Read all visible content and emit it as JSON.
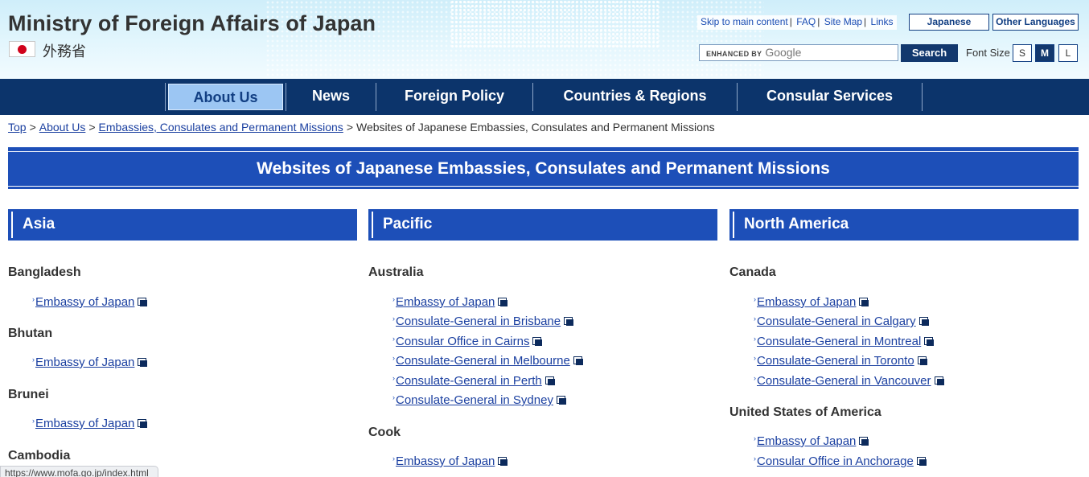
{
  "header": {
    "site_title": "Ministry of Foreign Affairs of Japan",
    "japanese_name": "外務省",
    "utility_links": [
      "Skip to main content",
      "FAQ",
      "Site Map",
      "Links"
    ],
    "language_buttons": [
      "Japanese",
      "Other Languages"
    ],
    "search": {
      "enhanced_label": "ENHANCED BY",
      "google_label": "Google",
      "button_label": "Search"
    },
    "font_size": {
      "label": "Font Size",
      "options": [
        "S",
        "M",
        "L"
      ],
      "selected": "M"
    }
  },
  "nav": {
    "items": [
      "About Us",
      "News",
      "Foreign Policy",
      "Countries & Regions",
      "Consular Services"
    ],
    "active": "About Us"
  },
  "breadcrumb": {
    "links": [
      "Top",
      "About Us",
      "Embassies, Consulates and Permanent Missions"
    ],
    "separator": ">",
    "current": "Websites of Japanese Embassies, Consulates and Permanent Missions"
  },
  "page_title": "Websites of Japanese Embassies, Consulates and Permanent Missions",
  "columns": [
    {
      "heading": "Asia",
      "countries": [
        {
          "name": "Bangladesh",
          "links": [
            "Embassy of Japan"
          ]
        },
        {
          "name": "Bhutan",
          "links": [
            "Embassy of Japan"
          ]
        },
        {
          "name": "Brunei",
          "links": [
            "Embassy of Japan"
          ]
        },
        {
          "name": "Cambodia",
          "links": []
        }
      ]
    },
    {
      "heading": "Pacific",
      "countries": [
        {
          "name": "Australia",
          "links": [
            "Embassy of Japan",
            "Consulate-General in Brisbane",
            "Consular Office in Cairns",
            "Consulate-General in Melbourne",
            "Consulate-General in Perth",
            "Consulate-General in Sydney"
          ]
        },
        {
          "name": "Cook",
          "links": [
            "Embassy of Japan"
          ]
        }
      ]
    },
    {
      "heading": "North America",
      "countries": [
        {
          "name": "Canada",
          "links": [
            "Embassy of Japan",
            "Consulate-General in Calgary",
            "Consulate-General in Montreal",
            "Consulate-General in Toronto",
            "Consulate-General in Vancouver"
          ]
        },
        {
          "name": "United States of America",
          "links": [
            "Embassy of Japan",
            "Consular Office in Anchorage"
          ]
        }
      ]
    }
  ],
  "status_bar": "https://www.mofa.go.jp/index.html",
  "colors": {
    "nav_bg": "#0c346b",
    "heading_bg": "#1d4fb8",
    "link": "#1a3fa0",
    "active_tab": "#9cc6f3"
  }
}
